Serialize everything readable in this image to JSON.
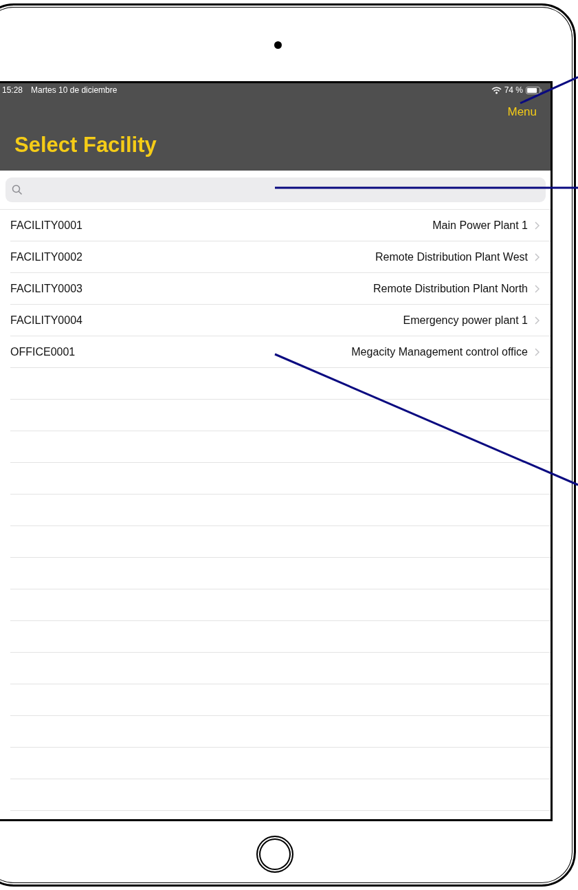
{
  "status_bar": {
    "time": "15:28",
    "date": "Martes 10 de diciembre",
    "battery": "74 %"
  },
  "nav_bar": {
    "menu_button": "Menu",
    "title": "Select Facility"
  },
  "facilities": [
    {
      "code": "FACILITY0001",
      "name": "Main Power Plant 1"
    },
    {
      "code": "FACILITY0002",
      "name": "Remote Distribution Plant West"
    },
    {
      "code": "FACILITY0003",
      "name": "Remote Distribution Plant North"
    },
    {
      "code": "FACILITY0004",
      "name": "Emergency power plant 1"
    },
    {
      "code": "OFFICE0001",
      "name": "Megacity Management control office"
    }
  ]
}
